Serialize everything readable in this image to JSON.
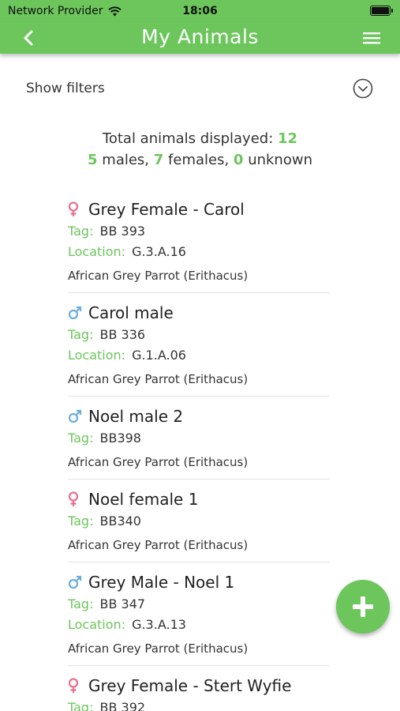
{
  "status_bar": {
    "carrier": "Network Provider",
    "time": "18:06"
  },
  "header": {
    "title": "My Animals"
  },
  "filters": {
    "label": "Show filters"
  },
  "summary": {
    "total_label": "Total animals displayed:",
    "total": "12",
    "males": "5",
    "males_label": "males,",
    "females": "7",
    "females_label": "females,",
    "unknown": "0",
    "unknown_label": "unknown"
  },
  "animals": [
    {
      "sex": "female",
      "name": "Grey Female - Carol",
      "tag_label": "Tag:",
      "tag": "BB 393",
      "location_label": "Location:",
      "location": "G.3.A.16",
      "species": "African Grey Parrot (Erithacus)"
    },
    {
      "sex": "male",
      "name": "Carol male",
      "tag_label": "Tag:",
      "tag": "BB 336",
      "location_label": "Location:",
      "location": "G.1.A.06",
      "species": "African Grey Parrot (Erithacus)"
    },
    {
      "sex": "male",
      "name": "Noel male 2",
      "tag_label": "Tag:",
      "tag": "BB398",
      "species": "African Grey Parrot (Erithacus)"
    },
    {
      "sex": "female",
      "name": "Noel female 1",
      "tag_label": "Tag:",
      "tag": "BB340",
      "species": "African Grey Parrot (Erithacus)"
    },
    {
      "sex": "male",
      "name": "Grey Male - Noel 1",
      "tag_label": "Tag:",
      "tag": "BB 347",
      "location_label": "Location:",
      "location": "G.3.A.13",
      "species": "African Grey Parrot (Erithacus)"
    },
    {
      "sex": "female",
      "name": "Grey Female - Stert Wyfie",
      "tag_label": "Tag:",
      "tag": "BB 392"
    }
  ],
  "icons": {
    "female": "female-symbol-icon",
    "male": "male-symbol-icon",
    "back": "chevron-left-icon",
    "menu": "hamburger-menu-icon",
    "toggle": "chevron-down-circle-icon",
    "add": "plus-icon"
  },
  "colors": {
    "accent": "#6cc65c",
    "female": "#e96f8e",
    "male": "#6aaedc"
  }
}
